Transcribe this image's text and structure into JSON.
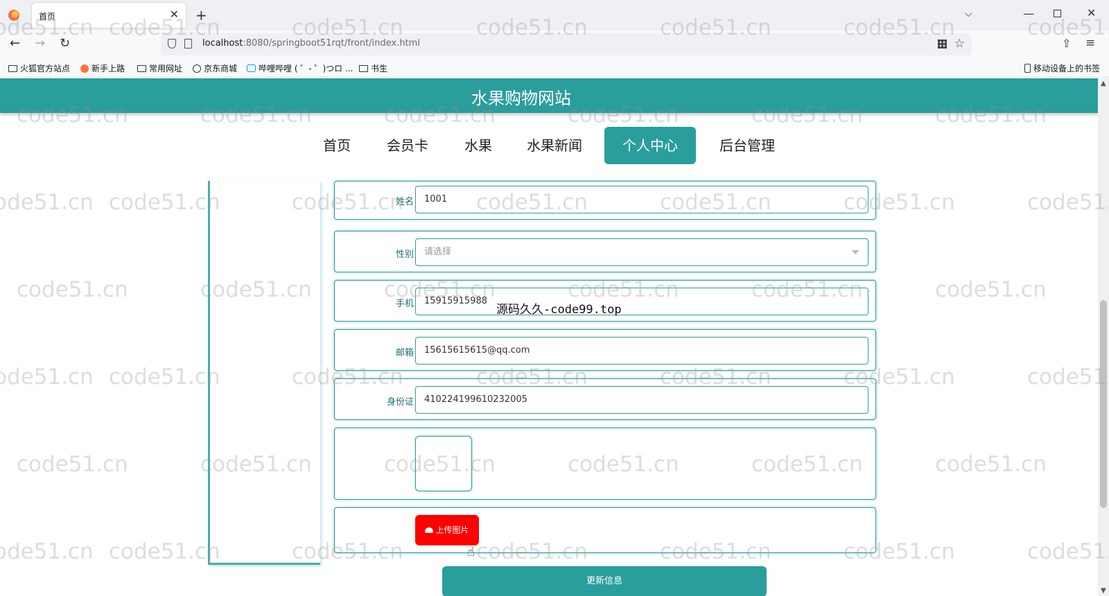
{
  "browser": {
    "tab_title": "首页",
    "close_glyph": "✕",
    "newtab_glyph": "+",
    "url_host": "localhost",
    "url_path": ":8080/springboot51rqt/front/index.html",
    "bookmarks": [
      "火狐官方站点",
      "新手上路",
      "常用网址",
      "京东商城",
      "哔哩哔哩 ( ゜- ゜)つロ ...",
      "书生"
    ],
    "mobile_bookmarks": "移动设备上的书签"
  },
  "site": {
    "title": "水果购物网站",
    "menu": [
      "首页",
      "会员卡",
      "水果",
      "水果新闻",
      "个人中心",
      "后台管理"
    ],
    "active_menu": "个人中心",
    "accent_color": "#2a9d9d"
  },
  "form": {
    "name_label": "姓名",
    "name_value": "1001",
    "gender_label": "性别",
    "gender_placeholder": "请选择",
    "phone_label": "手机",
    "phone_value": "15915915988",
    "email_label": "邮箱",
    "email_value": "15615615615@qq.com",
    "idcard_label": "身份证",
    "idcard_value": "410224199610232005",
    "upload_label": "上传图片",
    "submit_label": "更新信息",
    "upload_color": "#ff0000"
  },
  "overlay_text": "源码久久-code99.top",
  "watermark": "code51.cn"
}
